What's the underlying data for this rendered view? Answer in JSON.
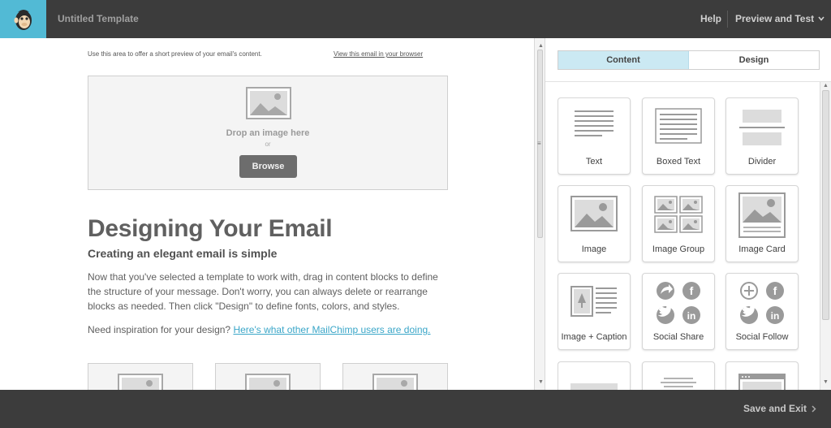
{
  "header": {
    "title": "Untitled Template",
    "help_label": "Help",
    "preview_label": "Preview and Test"
  },
  "editor": {
    "preheader_text": "Use this area to offer a short preview of your email's content.",
    "view_in_browser": "View this email in your browser",
    "dropzone": {
      "title": "Drop an image here",
      "or_label": "or",
      "browse_label": "Browse"
    },
    "heading": "Designing Your Email",
    "subheading": "Creating an elegant email is simple",
    "body": "Now that you've selected a template to work with, drag in content blocks to define the structure of your message. Don't worry, you can always delete or rearrange blocks as needed. Then click \"Design\" to define fonts, colors, and styles.",
    "inspiration_prefix": "Need inspiration for your design? ",
    "inspiration_link": "Here's what other MailChimp users are doing."
  },
  "panel": {
    "tabs": [
      {
        "label": "Content",
        "active": true
      },
      {
        "label": "Design",
        "active": false
      }
    ],
    "blocks": [
      {
        "label": "Text",
        "icon": "text-block-icon"
      },
      {
        "label": "Boxed Text",
        "icon": "boxed-text-icon"
      },
      {
        "label": "Divider",
        "icon": "divider-icon"
      },
      {
        "label": "Image",
        "icon": "image-icon"
      },
      {
        "label": "Image Group",
        "icon": "image-group-icon"
      },
      {
        "label": "Image Card",
        "icon": "image-card-icon"
      },
      {
        "label": "Image + Caption",
        "icon": "image-caption-icon"
      },
      {
        "label": "Social Share",
        "icon": "social-share-icon"
      },
      {
        "label": "Social Follow",
        "icon": "social-follow-icon"
      }
    ]
  },
  "footer": {
    "save_exit_label": "Save and Exit"
  },
  "colors": {
    "chrome": "#3c3c3c",
    "brand": "#52bad5",
    "active_tab": "#cbe9f3",
    "link": "#3aa6c8"
  }
}
